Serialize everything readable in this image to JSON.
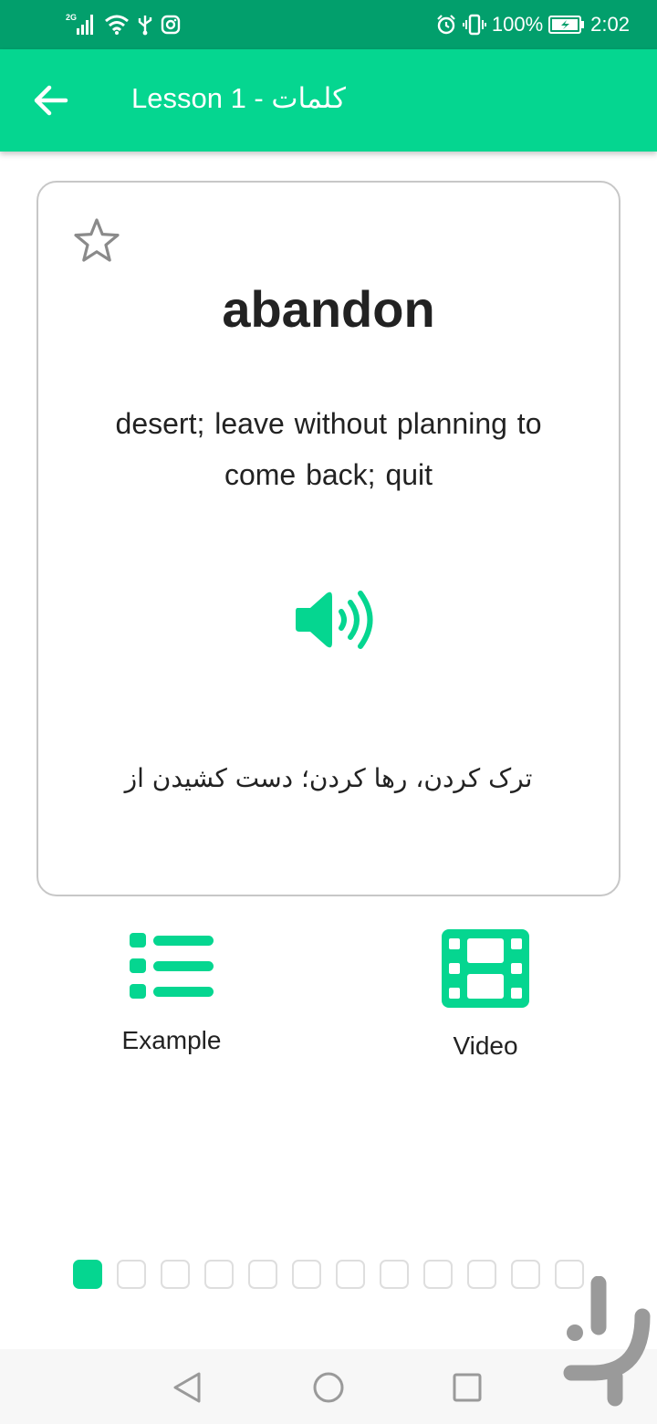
{
  "status_bar": {
    "network": "2G",
    "battery": "100%",
    "time": "2:02"
  },
  "app_bar": {
    "title": "Lesson 1 - کلمات"
  },
  "card": {
    "word": "abandon",
    "definition": "desert; leave without planning to come back; quit",
    "translation": "ترک کردن، رها کردن؛ دست کشیدن از"
  },
  "actions": {
    "example_label": "Example",
    "video_label": "Video"
  },
  "pager": {
    "total": 12,
    "current": 1
  },
  "colors": {
    "accent": "#05d690",
    "status_bar": "#029f6c",
    "text": "#222222"
  },
  "icons": {
    "back": "arrow-left-icon",
    "star": "star-outline-icon",
    "speaker": "volume-up-icon",
    "example": "list-icon",
    "video": "film-icon"
  }
}
